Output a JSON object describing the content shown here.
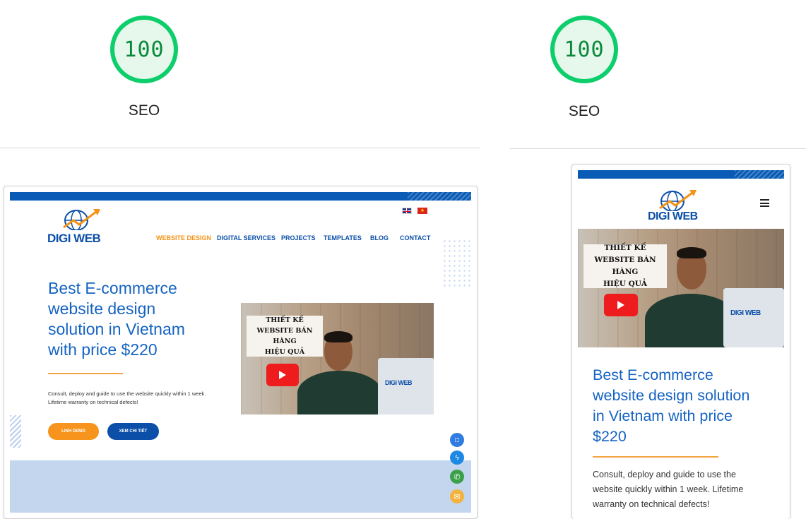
{
  "scores": [
    {
      "value": "100",
      "label": "SEO"
    },
    {
      "value": "100",
      "label": "SEO"
    }
  ],
  "brand": {
    "logo_text": "DIGI WEB"
  },
  "languages": [
    "EN",
    "VI"
  ],
  "nav": {
    "items": [
      "WEBSITE DESIGN",
      "DIGITAL SERVICES",
      "PROJECTS",
      "TEMPLATES",
      "BLOG",
      "CONTACT"
    ],
    "active_index": 0
  },
  "hero": {
    "title_desktop": [
      "Best E-commerce",
      "website design",
      "solution in Vietnam",
      "with price $220"
    ],
    "title_mobile": [
      "Best E-commerce",
      "website design solution",
      "in Vietnam with price",
      "$220"
    ],
    "text_desktop": [
      "Consult, deploy and guide to use the website quickly within 1 week.",
      "Lifetime warranty on technical defects!"
    ],
    "text_mobile": [
      "Consult, deploy and guide to use the",
      "website quickly within 1 week. Lifetime",
      "warranty on technical defects!"
    ],
    "btn_primary": "LINH DEMO",
    "btn_secondary": "XEM CHI TIẾT"
  },
  "video": {
    "caption_desktop": [
      "THIẾT KẾ",
      "WEBSITE BÁN HÀNG",
      "HIỆU QUẢ"
    ],
    "caption_mobile": [
      "THIẾT KẾ",
      "WEBSITE BÁN HÀNG",
      "HIỆU QUẢ"
    ],
    "laptop_logo": "DIGI WEB"
  },
  "floating_contacts": [
    "zalo-icon",
    "messenger-icon",
    "phone-icon",
    "email-icon"
  ],
  "colors": {
    "score_green": "#0cce6b",
    "brand_blue": "#0b4fa8",
    "accent_orange": "#f39214",
    "title_blue": "#1563c2"
  }
}
